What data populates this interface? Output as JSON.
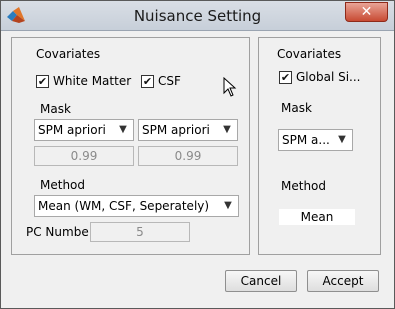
{
  "window": {
    "title": "Nuisance Setting",
    "close_glyph": "✕"
  },
  "left_panel": {
    "covariates_label": "Covariates",
    "white_matter": {
      "label": "White Matter",
      "checked": true
    },
    "csf": {
      "label": "CSF",
      "checked": true
    },
    "mask_label": "Mask",
    "mask1": {
      "value": "SPM apriori",
      "threshold": "0.99"
    },
    "mask2": {
      "value": "SPM apriori",
      "threshold": "0.99"
    },
    "method_label": "Method",
    "method_value": "Mean (WM, CSF, Seperately)",
    "pc_label": "PC Numbe",
    "pc_value": "5"
  },
  "right_panel": {
    "covariates_label": "Covariates",
    "global_signal": {
      "label": "Global Si...",
      "checked": true
    },
    "mask_label": "Mask",
    "mask_value": "SPM a...",
    "method_label": "Method",
    "method_value": "Mean"
  },
  "buttons": {
    "cancel": "Cancel",
    "accept": "Accept"
  },
  "icons": {
    "checkmark": "✔",
    "dropdown": "▼",
    "app": "matlab-icon",
    "cursor": "mouse-pointer-icon"
  }
}
